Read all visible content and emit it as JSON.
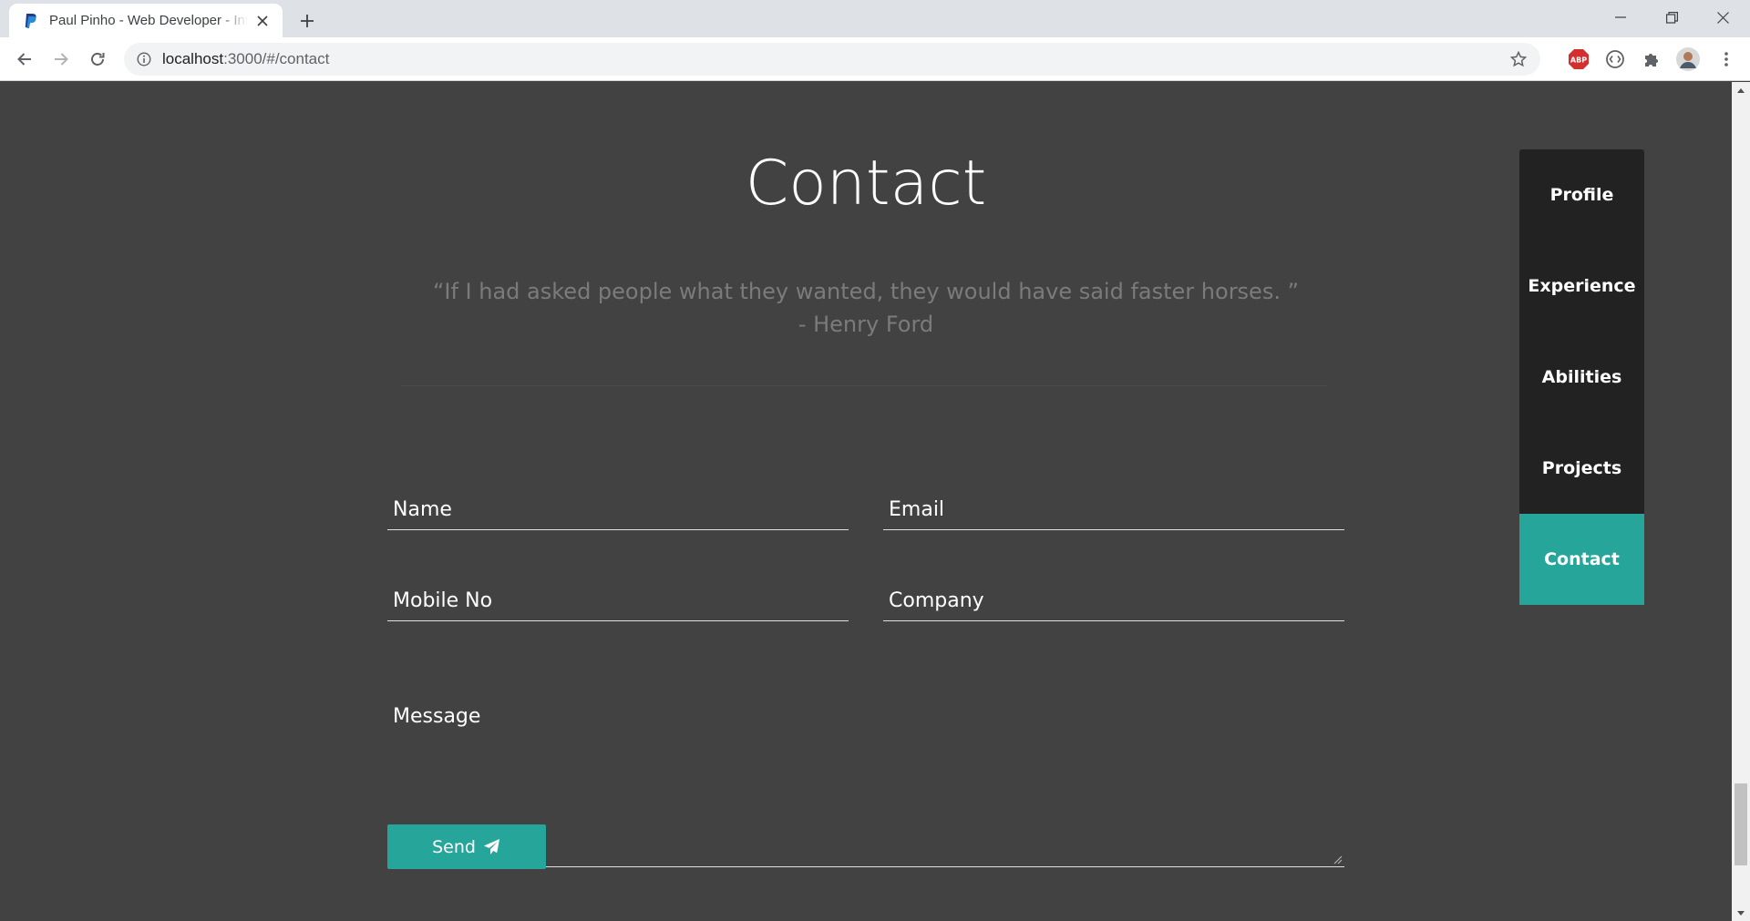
{
  "browser": {
    "tab_title": "Paul Pinho - Web Developer - Interactive Resume",
    "url_host": "localhost",
    "url_path": ":3000/#/contact"
  },
  "page": {
    "title": "Contact",
    "quote_line1": "“If I had asked people what they wanted, they would have said faster horses. ”",
    "quote_line2": "- Henry Ford"
  },
  "form": {
    "name_placeholder": "Name",
    "email_placeholder": "Email",
    "mobile_placeholder": "Mobile No",
    "company_placeholder": "Company",
    "message_placeholder": "Message",
    "send_label": "Send"
  },
  "sidenav": {
    "items": [
      {
        "label": "Profile",
        "active": false
      },
      {
        "label": "Experience",
        "active": false
      },
      {
        "label": "Abilities",
        "active": false
      },
      {
        "label": "Projects",
        "active": false
      },
      {
        "label": "Contact",
        "active": true
      }
    ]
  },
  "colors": {
    "page_bg": "#424242",
    "accent": "#26a69a",
    "nav_bg": "#222222",
    "quote_text": "#7b7b7b"
  },
  "icons": [
    "paypal-favicon-icon",
    "close-icon",
    "plus-icon",
    "minimize-icon",
    "restore-icon",
    "back-icon",
    "forward-icon",
    "reload-icon",
    "info-icon",
    "star-icon",
    "adblock-icon",
    "extension-icon",
    "puzzle-icon",
    "avatar",
    "more-vert-icon",
    "paper-plane-icon"
  ]
}
